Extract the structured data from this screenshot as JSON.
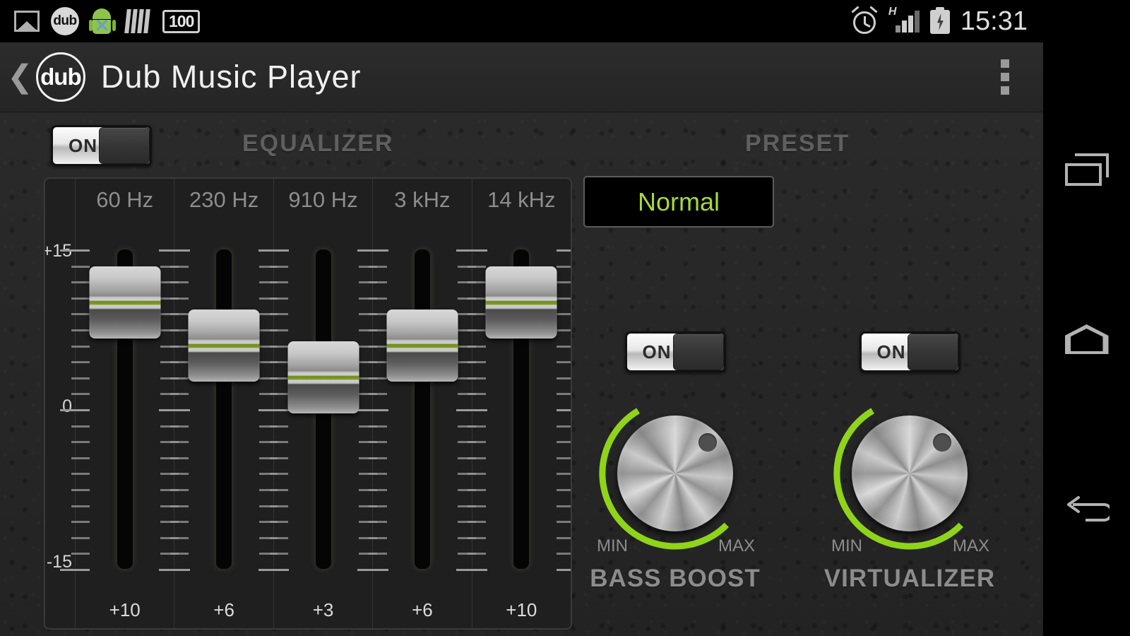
{
  "status_bar": {
    "icons_left": [
      "image-icon",
      "dub-app-icon",
      "android-icon",
      "bars-icon",
      "badge-100-icon"
    ],
    "dub_badge": "dub",
    "battery_badge": "100",
    "icons_right": [
      "alarm-icon",
      "signal-h-icon",
      "battery-charging-icon"
    ],
    "network_type": "H",
    "time": "15:31"
  },
  "action_bar": {
    "back_chevron": "❮",
    "logo_text": "dub",
    "title": "Dub Music Player",
    "overflow_label": "more-options"
  },
  "equalizer": {
    "toggle_label": "ON",
    "toggle_state": "on",
    "heading": "EQUALIZER",
    "scale": {
      "top": "+15",
      "mid": "0",
      "bottom": "-15",
      "min": -15,
      "max": 15
    },
    "bands": [
      {
        "freq": "60 Hz",
        "gain_label": "+10",
        "gain": 10
      },
      {
        "freq": "230 Hz",
        "gain_label": "+6",
        "gain": 6
      },
      {
        "freq": "910 Hz",
        "gain_label": "+3",
        "gain": 3
      },
      {
        "freq": "3 kHz",
        "gain_label": "+6",
        "gain": 6
      },
      {
        "freq": "14 kHz",
        "gain_label": "+10",
        "gain": 10
      }
    ]
  },
  "preset": {
    "heading": "PRESET",
    "value": "Normal",
    "value_color": "#a6d93a"
  },
  "effects": [
    {
      "id": "bass-boost",
      "name": "BASS BOOST",
      "toggle_label": "ON",
      "toggle_state": "on",
      "min_label": "MIN",
      "max_label": "MAX",
      "arc_color": "#8fd419",
      "level_percent": 72
    },
    {
      "id": "virtualizer",
      "name": "VIRTUALIZER",
      "toggle_label": "ON",
      "toggle_state": "on",
      "min_label": "MIN",
      "max_label": "MAX",
      "arc_color": "#8fd419",
      "level_percent": 72
    }
  ],
  "nav_bar": {
    "buttons": [
      "recents-icon",
      "home-icon",
      "back-icon"
    ]
  }
}
